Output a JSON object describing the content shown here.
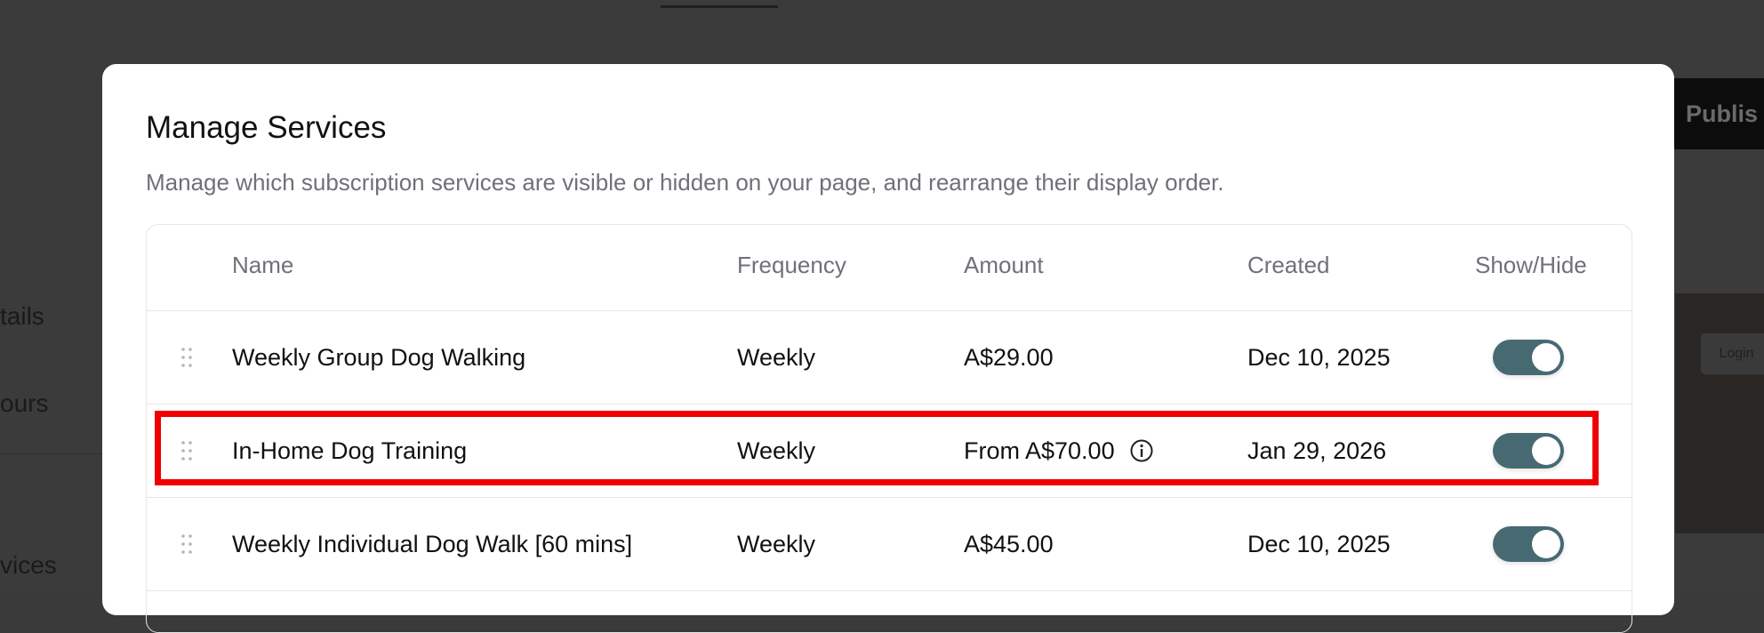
{
  "background": {
    "sidebar_items": [
      "tails",
      "ours",
      "vices"
    ],
    "publish_label": "Publis",
    "login_label": "Login"
  },
  "modal": {
    "title": "Manage Services",
    "description": "Manage which subscription services are visible or hidden on your page, and rearrange their display order.",
    "columns": {
      "name": "Name",
      "frequency": "Frequency",
      "amount": "Amount",
      "created": "Created",
      "show_hide": "Show/Hide"
    },
    "rows": [
      {
        "name": "Weekly Group Dog Walking",
        "frequency": "Weekly",
        "amount": "A$29.00",
        "created": "Dec 10, 2025",
        "visible": true
      },
      {
        "name": "In-Home Dog Training",
        "frequency": "Weekly",
        "amount": "From A$70.00",
        "created": "Jan 29, 2026",
        "visible": true,
        "info": true
      },
      {
        "name": "Weekly Individual Dog Walk [60 mins]",
        "frequency": "Weekly",
        "amount": "A$45.00",
        "created": "Dec 10, 2025",
        "visible": true
      }
    ]
  },
  "colors": {
    "toggle_on": "#476a72",
    "highlight": "#f00000",
    "overlay": "#3a3a3a"
  }
}
